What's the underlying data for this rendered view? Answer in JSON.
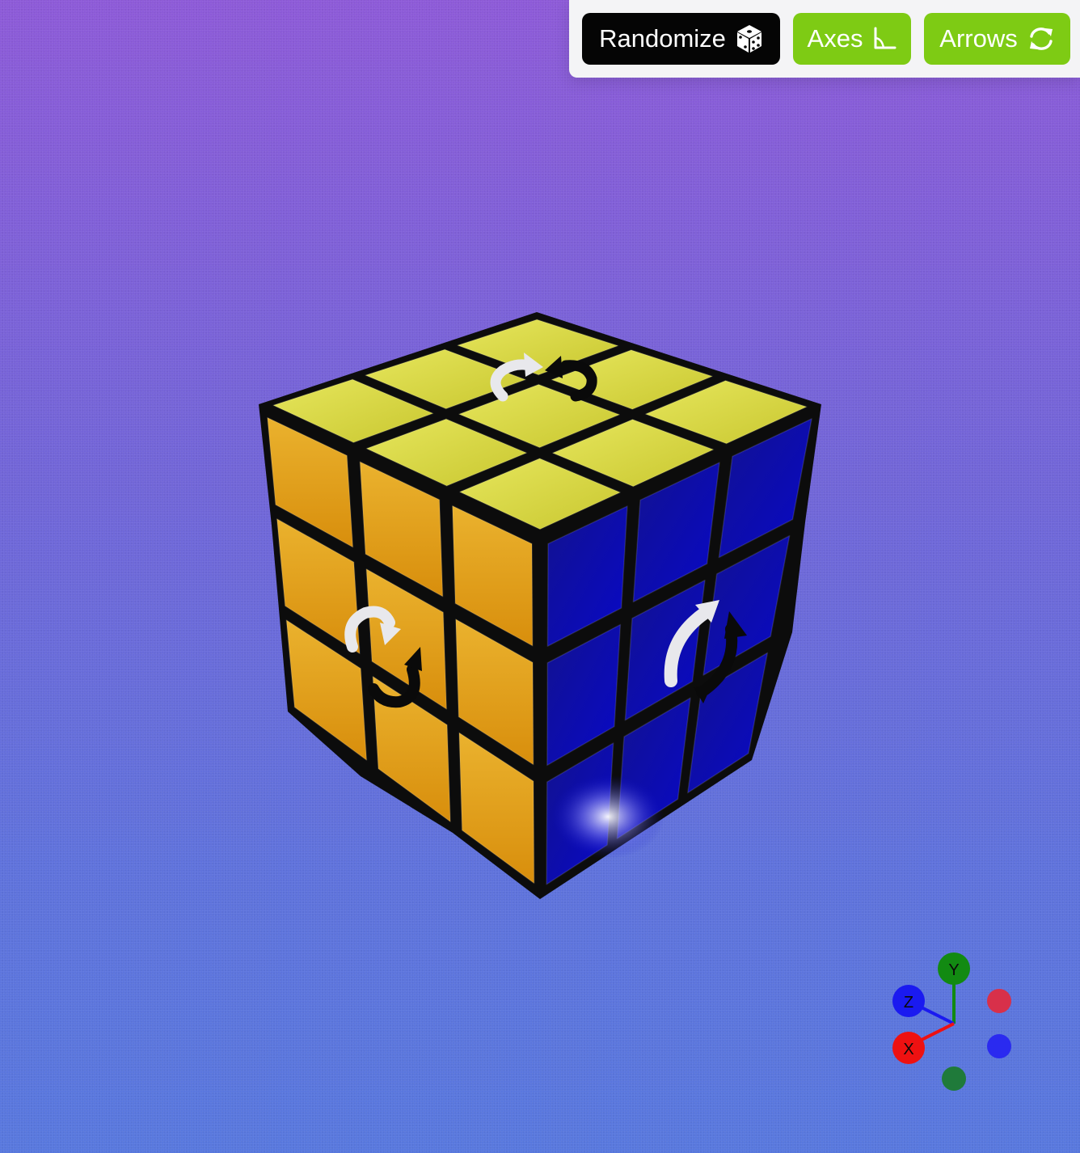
{
  "toolbar": {
    "randomize_label": "Randomize",
    "randomize_icon": "dice-icon",
    "axes_label": "Axes",
    "axes_icon": "axes-icon",
    "arrows_label": "Arrows",
    "arrows_icon": "rotate-arrows-icon"
  },
  "colors": {
    "background_top": "#8d5ad8",
    "background_bottom": "#5878de",
    "toolbar_bg": "#f4f4f6",
    "randomize_bg": "#050505",
    "toggle_bg": "#7ecb14",
    "face_top": "#d4d43a",
    "face_left": "#e2a41a",
    "face_right": "#0a0ab0"
  },
  "cube": {
    "faces": {
      "top": [
        "yellow",
        "yellow",
        "yellow",
        "yellow",
        "yellow",
        "yellow",
        "yellow",
        "yellow",
        "yellow"
      ],
      "left": [
        "orange",
        "orange",
        "orange",
        "orange",
        "orange",
        "orange",
        "orange",
        "orange",
        "orange"
      ],
      "right": [
        "blue",
        "blue",
        "blue",
        "blue",
        "blue",
        "blue",
        "blue",
        "blue",
        "blue"
      ]
    }
  },
  "gizmo": {
    "x_label": "X",
    "y_label": "Y",
    "z_label": "Z",
    "x_color": "#ee1111",
    "y_color": "#128a12",
    "z_color": "#1a1af0",
    "neg_x_color": "#d8304a",
    "neg_y_color": "#1f7a3a",
    "neg_z_color": "#2a2af0"
  }
}
